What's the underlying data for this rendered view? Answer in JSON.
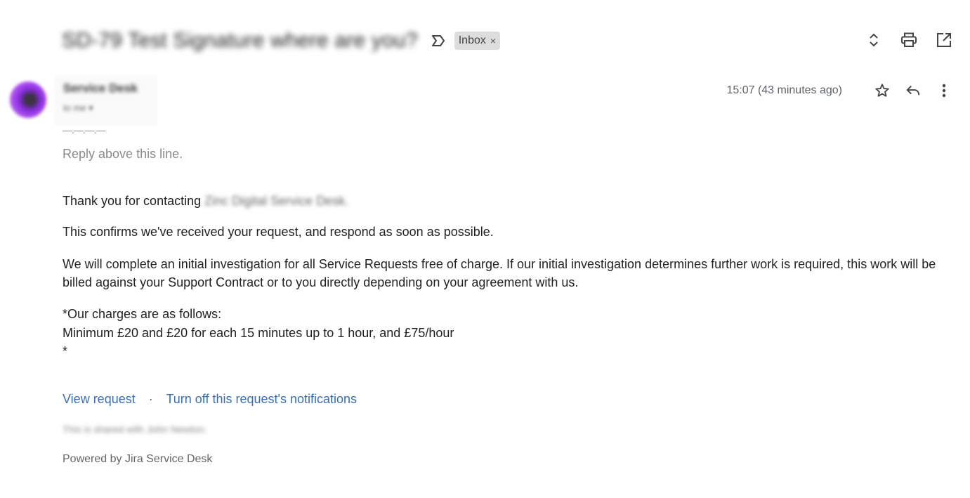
{
  "header": {
    "subject": "SD-79 Test Signature where are you?",
    "importance_icon": "importance-marker-icon",
    "label_chip": {
      "label": "Inbox",
      "remove_symbol": "×"
    },
    "actions": [
      {
        "name": "expand-collapse-icon"
      },
      {
        "name": "print-icon"
      },
      {
        "name": "open-in-new-window-icon"
      }
    ]
  },
  "message": {
    "sender_name": "Service Desk",
    "sender_to": "to me ▾",
    "timestamp": "15:07 (43 minutes ago)",
    "actions": [
      {
        "name": "star-icon"
      },
      {
        "name": "reply-icon"
      },
      {
        "name": "more-options-icon"
      }
    ]
  },
  "body": {
    "separator": "—.—.—.—",
    "reply_above": "Reply above this line.",
    "thanks_prefix": "Thank you for contacting",
    "company_name": "Zinc Digital Service Desk.",
    "confirm": "This confirms we've received your request, and respond as soon as possible.",
    "investigation": "We will complete an initial investigation for all Service Requests free of charge. If our initial investigation determines further work is required, this work will be billed against your Support Contract or to you directly depending on your agreement with us.",
    "charges_title": "*Our charges are as follows:",
    "charges_detail": "Minimum £20 and £20 for each 15 minutes up to 1 hour, and £75/hour",
    "charges_end": "*",
    "links": {
      "view_request": "View request",
      "separator": "·",
      "turn_off": "Turn off this request's notifications"
    },
    "shared_note": "This is shared with John Newton.",
    "powered_by": "Powered by Jira Service Desk"
  }
}
